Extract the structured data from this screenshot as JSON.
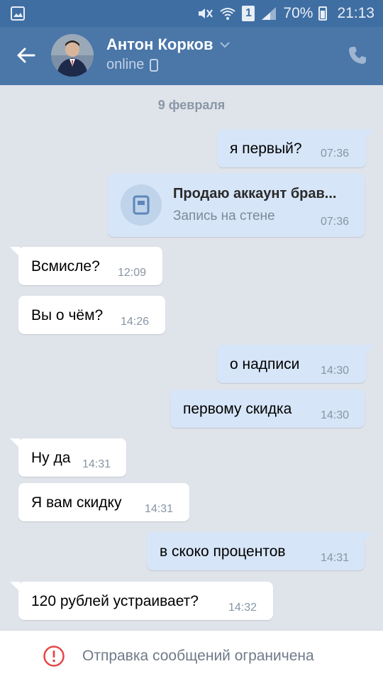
{
  "status_bar": {
    "battery": "70%",
    "time": "21:13",
    "sim": "1",
    "icons": [
      "gallery-icon",
      "mute-icon",
      "wifi-icon",
      "sim-icon",
      "signal-icon",
      "battery-icon"
    ]
  },
  "header": {
    "contact_name": "Антон Корков",
    "status": "online",
    "icons": [
      "back-arrow-icon",
      "chevron-down-icon",
      "mobile-icon",
      "phone-icon"
    ]
  },
  "chat": {
    "date": "9 февраля",
    "messages": [
      {
        "dir": "out",
        "text": "я первый?",
        "time": "07:36"
      },
      {
        "dir": "out",
        "type": "wall-post",
        "title": "Продаю аккаунт брав...",
        "subtitle": "Запись на стене",
        "time": "07:36"
      },
      {
        "dir": "in",
        "text": "Всмисле?",
        "time": "12:09"
      },
      {
        "dir": "in",
        "text": "Вы о чём?",
        "time": "14:26"
      },
      {
        "dir": "out",
        "text": "о надписи",
        "time": "14:30"
      },
      {
        "dir": "out",
        "text": "первому скидка",
        "time": "14:30"
      },
      {
        "dir": "in",
        "text": "Ну да",
        "time": "14:31"
      },
      {
        "dir": "in",
        "text": "Я вам скидку",
        "time": "14:31"
      },
      {
        "dir": "out",
        "text": "в скоко процентов",
        "time": "14:31"
      },
      {
        "dir": "in",
        "text": "120 рублей устраивает?",
        "time": "14:32"
      }
    ]
  },
  "footer": {
    "notice": "Отправка сообщений ограничена",
    "icon": "warning-icon"
  },
  "colors": {
    "header_bg": "#4a76a8",
    "status_bg": "#3f6ea3",
    "chat_bg": "#dfe3ea",
    "bubble_out": "#d6e5f7",
    "bubble_in": "#ffffff",
    "warning": "#e64646"
  }
}
